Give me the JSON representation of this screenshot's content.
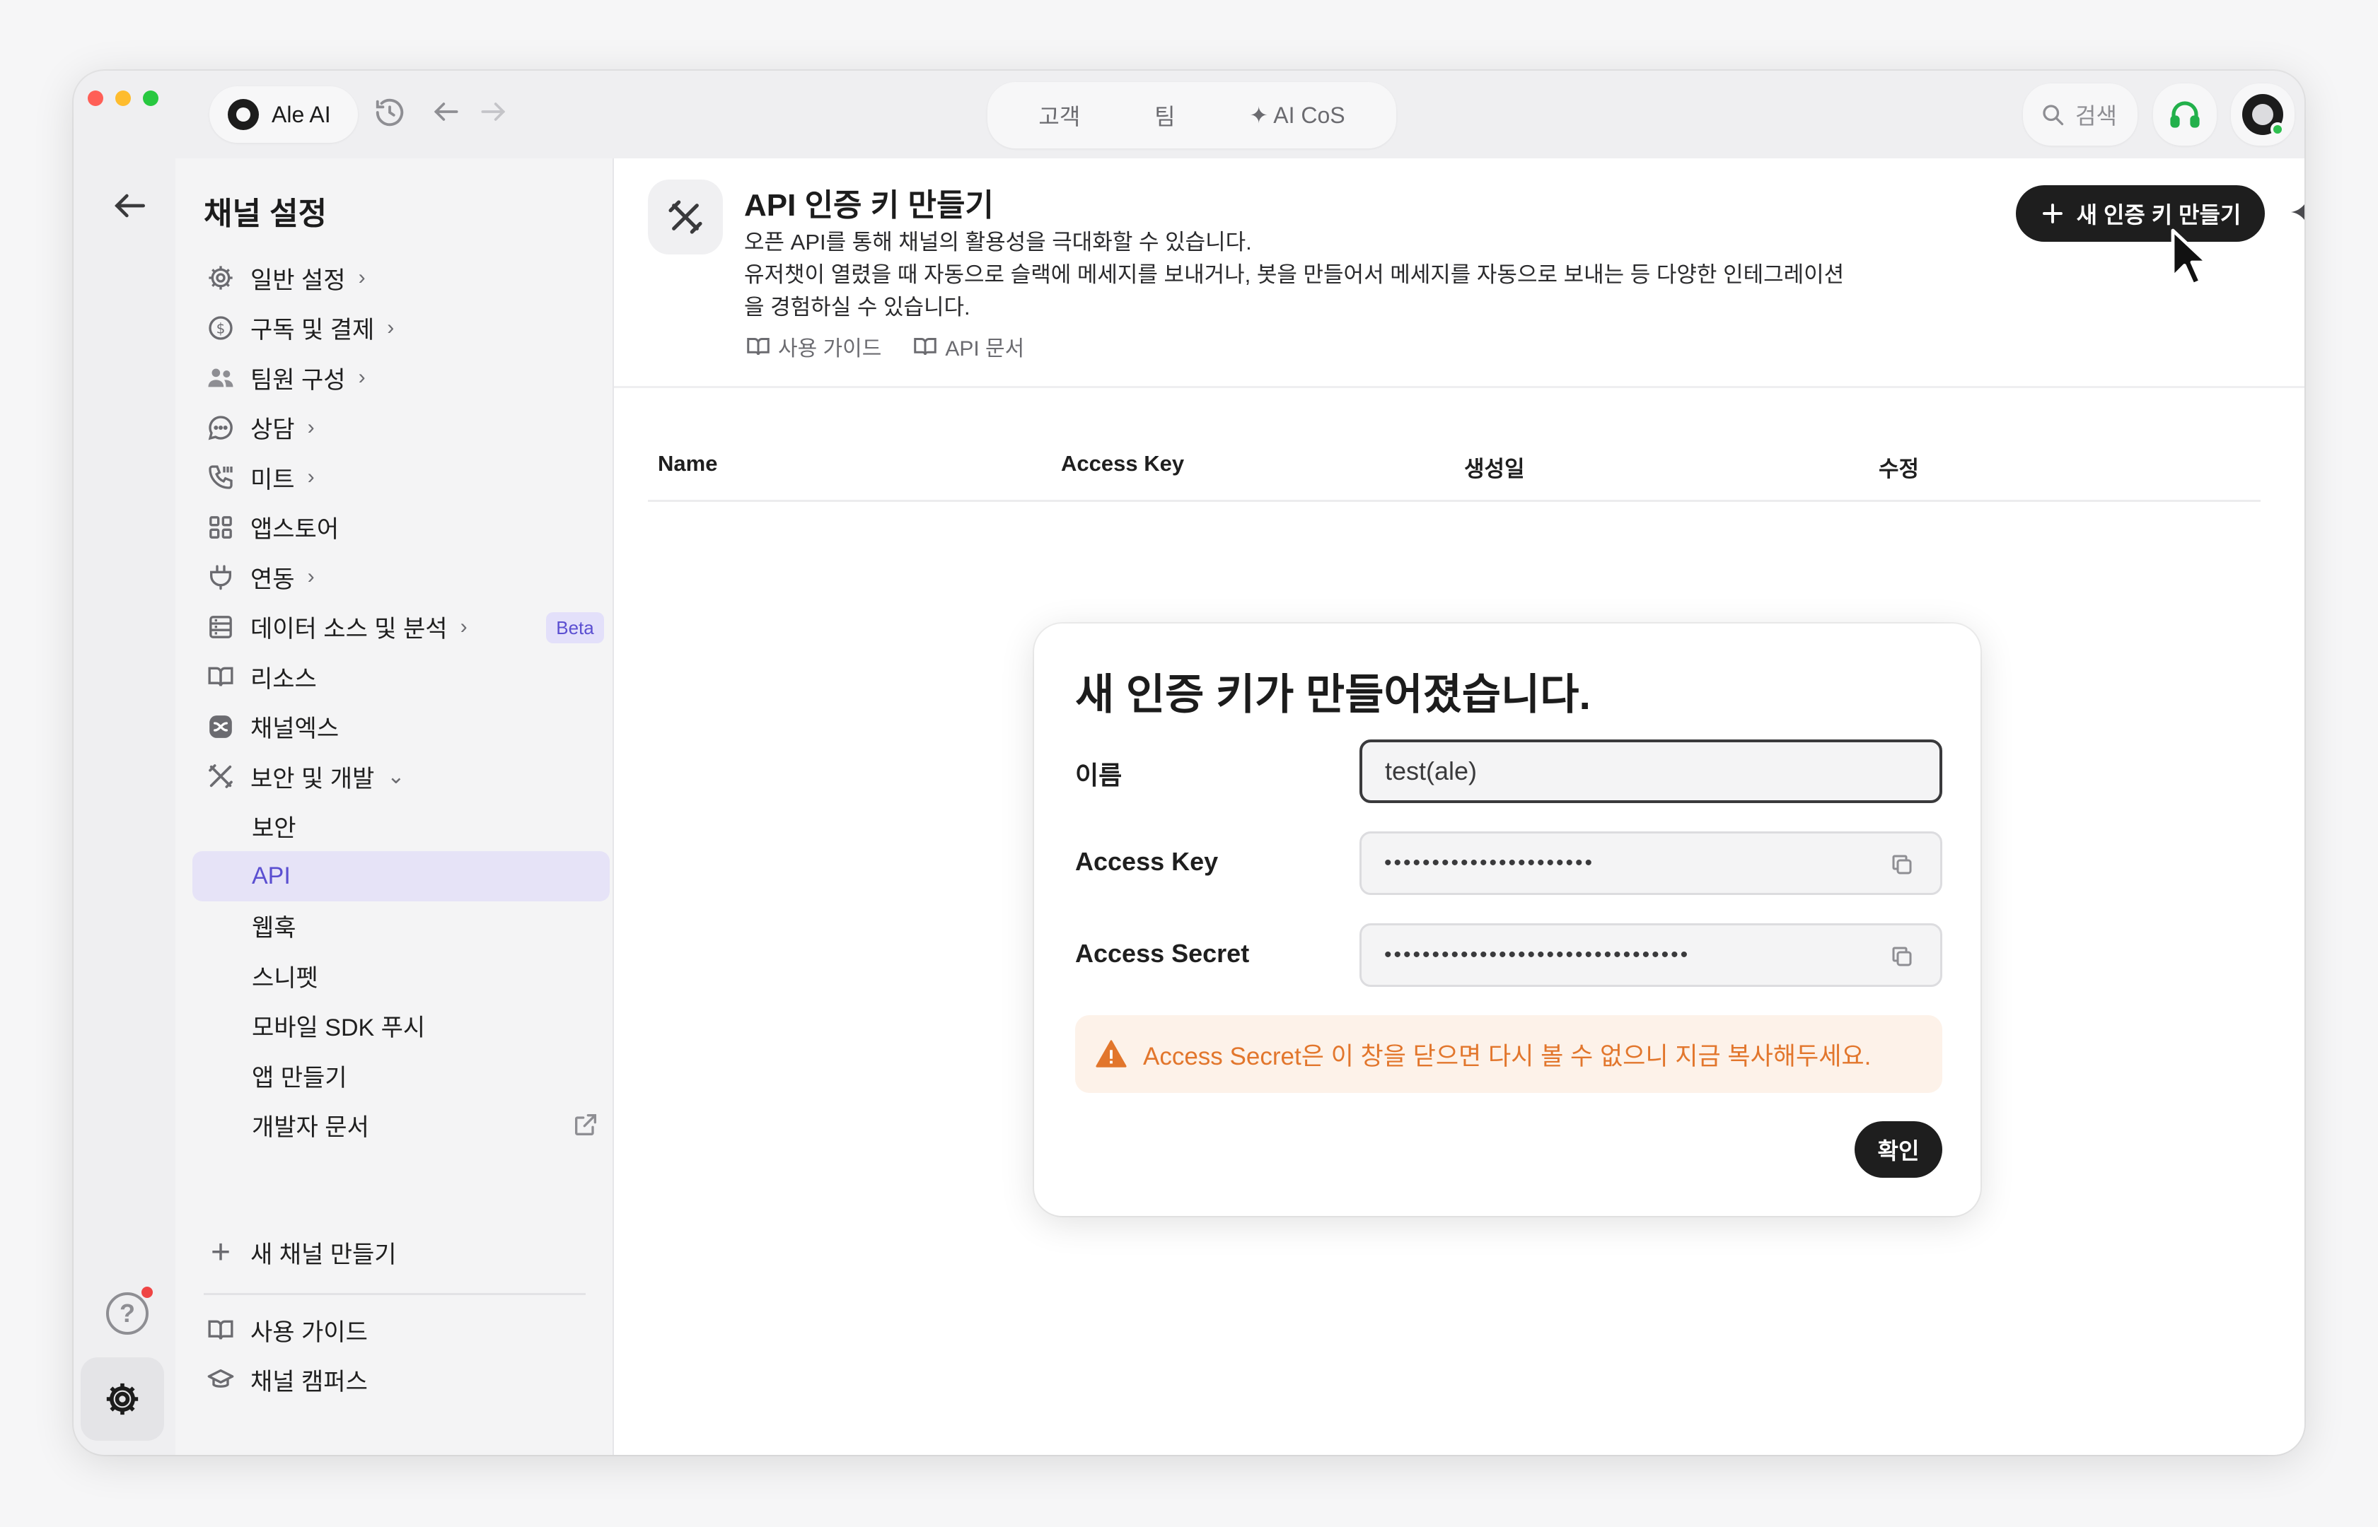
{
  "app": {
    "name": "Ale AI"
  },
  "top_tabs": [
    {
      "label": "고객"
    },
    {
      "label": "팀"
    },
    {
      "label": "✦ AI CoS"
    }
  ],
  "search": {
    "label": "검색"
  },
  "sidebar": {
    "title": "채널 설정",
    "items": [
      {
        "label": "일반 설정",
        "icon": "gear-icon",
        "chevron": "›"
      },
      {
        "label": "구독 및 결제",
        "icon": "dollar-circle-icon",
        "chevron": "›"
      },
      {
        "label": "팀원 구성",
        "icon": "users-icon",
        "chevron": "›"
      },
      {
        "label": "상담",
        "icon": "chat-bubble-icon",
        "chevron": "›"
      },
      {
        "label": "미트",
        "icon": "phone-icon",
        "chevron": "›"
      },
      {
        "label": "앱스토어",
        "icon": "grid-icon"
      },
      {
        "label": "연동",
        "icon": "plug-icon",
        "chevron": "›"
      },
      {
        "label": "데이터 소스 및 분석",
        "icon": "database-icon",
        "chevron": "›",
        "badge": "Beta"
      },
      {
        "label": "리소스",
        "icon": "book-icon"
      },
      {
        "label": "채널엑스",
        "icon": "channelx-icon"
      },
      {
        "label": "보안 및 개발",
        "icon": "tools-icon",
        "chevron": "⌄"
      }
    ],
    "sub_items": [
      {
        "label": "보안"
      },
      {
        "label": "API"
      },
      {
        "label": "웹훅"
      },
      {
        "label": "스니펫"
      },
      {
        "label": "모바일 SDK 푸시"
      },
      {
        "label": "앱 만들기"
      },
      {
        "label": "개발자 문서"
      }
    ],
    "new_channel": "새 채널 만들기",
    "bottom": [
      {
        "label": "사용 가이드",
        "icon": "book-icon"
      },
      {
        "label": "채널 캠퍼스",
        "icon": "graduation-cap-icon"
      }
    ]
  },
  "header": {
    "title": "API 인증 키 만들기",
    "desc_line1": "오픈 API를 통해 채널의 활용성을 극대화할 수 있습니다.",
    "desc_line2": "유저챗이 열렸을 때 자동으로 슬랙에 메세지를 보내거나, 봇을 만들어서 메세지를 자동으로 보내는 등 다양한 인테그레이션",
    "desc_line3": "을 경험하실 수 있습니다.",
    "link_guide": "사용 가이드",
    "link_api_docs": "API 문서",
    "new_key_button": "새 인증 키 만들기"
  },
  "table": {
    "columns": [
      "Name",
      "Access Key",
      "생성일",
      "수정"
    ]
  },
  "modal": {
    "title": "새 인증 키가 만들어졌습니다.",
    "name_label": "이름",
    "name_value": "test(ale)",
    "access_key_label": "Access Key",
    "access_key_value": "••••••••••••••••••••••",
    "access_secret_label": "Access Secret",
    "access_secret_value": "••••••••••••••••••••••••••••••••",
    "warning": "Access Secret은 이 창을 닫으면 다시 볼 수 없으니 지금 복사해두세요.",
    "confirm_button": "확인"
  },
  "colors": {
    "accent": "#5b4fd1",
    "warning_text": "#e2762c",
    "warning_bg": "#fdf2e9",
    "primary_button": "#1e1e1e",
    "online": "#2fbf4f"
  }
}
